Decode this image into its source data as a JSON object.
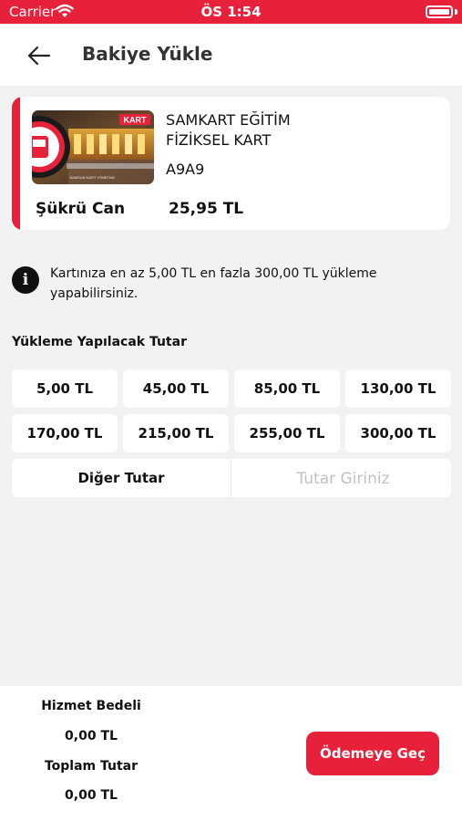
{
  "status_bar": {
    "carrier": "Carrier",
    "time": "ÖS 1:54"
  },
  "nav": {
    "title": "Bakiye Yükle"
  },
  "card": {
    "title_line1": "SAMKART EĞİTİM",
    "title_line2": "FİZİKSEL KART",
    "code": "A9A9",
    "owner": "Şükrü Can",
    "balance": "25,95 TL",
    "brand_text": "KART",
    "image_caption": "SAMSUN KART YÖNETİMİ"
  },
  "info": {
    "text": "Kartınıza en az 5,00 TL en fazla 300,00 TL yükleme yapabilirsiniz."
  },
  "amount_section": {
    "label": "Yükleme Yapılacak Tutar",
    "options": [
      "5,00 TL",
      "45,00 TL",
      "85,00 TL",
      "130,00 TL",
      "170,00 TL",
      "215,00 TL",
      "255,00 TL",
      "300,00 TL"
    ],
    "other_label": "Diğer Tutar",
    "other_placeholder": "Tutar Giriniz"
  },
  "footer": {
    "service_fee_label": "Hizmet Bedeli",
    "service_fee_value": "0,00 TL",
    "total_label": "Toplam Tutar",
    "total_value": "0,00 TL",
    "pay_button": "Ödemeye Geç"
  },
  "colors": {
    "accent": "#e8213a",
    "background": "#f2f2f4"
  }
}
